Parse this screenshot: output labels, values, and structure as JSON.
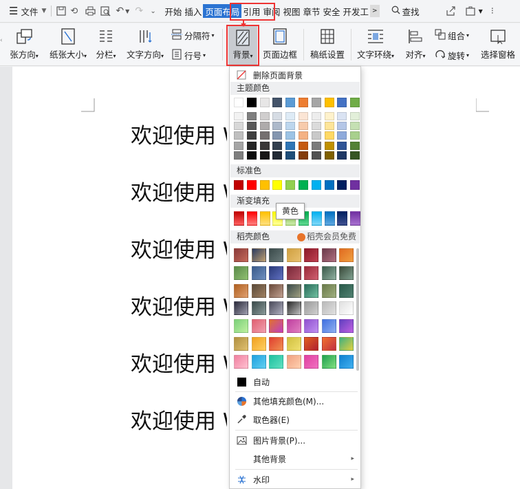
{
  "menubar": {
    "file_label": "文件",
    "tabs": [
      "开始",
      "插入",
      "页面布局",
      "引用",
      "审阅",
      "视图",
      "章节",
      "安全",
      "开发工"
    ],
    "active_tab": "页面布局",
    "more_glyph": ">",
    "search_label": "查找"
  },
  "ribbon": {
    "orientation": "张方向",
    "size": "纸张大小",
    "columns": "分栏",
    "text_direction": "文字方向",
    "separator": "分隔符",
    "line_number": "行号",
    "background": "背景",
    "page_border": "页面边框",
    "paper_setup": "稿纸设置",
    "text_wrap": "文字环绕",
    "align": "对齐",
    "group": "组合",
    "rotate": "旋转",
    "selection_pane": "选择窗格"
  },
  "document": {
    "lines": [
      "欢迎使用 W",
      "欢迎使用 W",
      "欢迎使用 W",
      "欢迎使用 W",
      "欢迎使用 W",
      "欢迎使用 W"
    ]
  },
  "dropdown": {
    "remove_bg": "删除页面背景",
    "theme_colors_title": "主题颜色",
    "standard_colors_title": "标准色",
    "gradient_title": "渐变填充",
    "docer_title": "稻壳颜色",
    "docer_vip": "稻壳会员免费",
    "auto": "自动",
    "more_fill": "其他填充颜色(M)...",
    "eyedropper": "取色器(E)",
    "picture_bg": "图片背景(P)...",
    "other_bg": "其他背景",
    "watermark": "水印",
    "tooltip": "黄色",
    "theme_top": [
      "#ffffff",
      "#000000",
      "#e7e6e6",
      "#44546a",
      "#5b9bd5",
      "#ed7d31",
      "#a5a5a5",
      "#ffc000",
      "#4472c4",
      "#70ad47"
    ],
    "theme_shades": [
      [
        "#f2f2f2",
        "#7f7f7f",
        "#d0cece",
        "#d6dce4",
        "#deebf6",
        "#fbe5d5",
        "#ededed",
        "#fff2cc",
        "#dae3f3",
        "#e2efd9"
      ],
      [
        "#d8d8d8",
        "#595959",
        "#aeabab",
        "#adb9ca",
        "#bdd7ee",
        "#f7cbac",
        "#dbdbdb",
        "#fee599",
        "#b4c6e7",
        "#c5e0b3"
      ],
      [
        "#bfbfbf",
        "#3f3f3f",
        "#757070",
        "#8496b0",
        "#9cc3e5",
        "#f4b183",
        "#c9c9c9",
        "#ffd965",
        "#8eaadb",
        "#a8d08d"
      ],
      [
        "#a5a5a5",
        "#262626",
        "#3a3838",
        "#323f4f",
        "#2e75b5",
        "#c55a11",
        "#7b7b7b",
        "#bf9000",
        "#2f5496",
        "#538135"
      ],
      [
        "#7f7f7f",
        "#0c0c0c",
        "#171616",
        "#222a35",
        "#1e4e79",
        "#843c0b",
        "#525252",
        "#7f6000",
        "#1f3864",
        "#375623"
      ]
    ],
    "standard": [
      "#c00000",
      "#ff0000",
      "#ffc000",
      "#ffff00",
      "#92d050",
      "#00b050",
      "#00b0f0",
      "#0070c0",
      "#002060",
      "#7030a0"
    ],
    "gradients": [
      [
        "#c00000",
        "#ff6060"
      ],
      [
        "#ff0000",
        "#ff8080"
      ],
      [
        "#ffc000",
        "#ffe080"
      ],
      [
        "#ffff00",
        "#ffff9a"
      ],
      [
        "#92d050",
        "#c8e8a8"
      ],
      [
        "#00b050",
        "#60d890"
      ],
      [
        "#00b0f0",
        "#80d8f8"
      ],
      [
        "#0070c0",
        "#60a8e0"
      ],
      [
        "#002060",
        "#405090"
      ],
      [
        "#7030a0",
        "#a870d0"
      ]
    ],
    "docer": [
      [
        [
          "#8a3a3a",
          "#c56a5a"
        ],
        [
          "#2a3a60",
          "#c0a070"
        ],
        [
          "#3a4a4a",
          "#6a7a7a"
        ],
        [
          "#d0a040",
          "#e8c070"
        ],
        [
          "#8a1a2a",
          "#c04050"
        ],
        [
          "#6a3a4a",
          "#b07080"
        ],
        [
          "#e06a20",
          "#f0a040"
        ]
      ],
      [
        [
          "#5a8a4a",
          "#90c070"
        ],
        [
          "#3a5a8a",
          "#7090c0"
        ],
        [
          "#2a3a7a",
          "#6070c0"
        ],
        [
          "#7a2a3a",
          "#b05060"
        ],
        [
          "#9a2a3a",
          "#d06070"
        ],
        [
          "#3a5a4a",
          "#90b0a0"
        ],
        [
          "#3a4a3a",
          "#80a090"
        ]
      ],
      [
        [
          "#b06020",
          "#e0a070"
        ],
        [
          "#5a4a3a",
          "#a08060"
        ],
        [
          "#6a4a3a",
          "#c0a090"
        ],
        [
          "#3a4a4a",
          "#a0a080"
        ],
        [
          "#2a6a5a",
          "#70c0a0"
        ],
        [
          "#6a7a4a",
          "#a0b080"
        ],
        [
          "#2a5a4a",
          "#508070"
        ]
      ],
      [
        [
          "#2a2a3a",
          "#a0a0b0"
        ],
        [
          "#3a4a4a",
          "#8a9a9a"
        ],
        [
          "#4a4a5a",
          "#b0b0c0"
        ],
        [
          "#2a2a2a",
          "#c0c0c0"
        ],
        [
          "#9a9a9a",
          "#d0d0d0"
        ],
        [
          "#bababa",
          "#e0e0e0"
        ],
        [
          "#e0e0e0",
          "#ffffff"
        ]
      ],
      [
        [
          "#7ad07a",
          "#c0f0a0"
        ],
        [
          "#e06070",
          "#f0a0b0"
        ],
        [
          "#e07030",
          "#c040c0"
        ],
        [
          "#c040a0",
          "#e080c0"
        ],
        [
          "#9050d0",
          "#c090f0"
        ],
        [
          "#4070e0",
          "#90b0f0"
        ],
        [
          "#6040c0",
          "#c060e0"
        ]
      ],
      [
        [
          "#b09040",
          "#e0c070"
        ],
        [
          "#f0a020",
          "#ffd060"
        ],
        [
          "#e04030",
          "#f09050"
        ],
        [
          "#d0c040",
          "#f0e070"
        ],
        [
          "#e06020",
          "#b02030"
        ],
        [
          "#f07030",
          "#c03040"
        ],
        [
          "#40b080",
          "#e0d040"
        ]
      ],
      [
        [
          "#f080a0",
          "#ffc0d0"
        ],
        [
          "#20a0e0",
          "#60d0f0"
        ],
        [
          "#20c0a0",
          "#60e0c0"
        ],
        [
          "#f0a080",
          "#ffd0b0"
        ],
        [
          "#e040a0",
          "#f070c0"
        ],
        [
          "#20a050",
          "#80e080"
        ],
        [
          "#1080d0",
          "#40b0f0"
        ]
      ]
    ],
    "auto_color": "#000000"
  },
  "colors": {
    "accent_blue": "#2b73d2",
    "highlight_red": "#e33333",
    "docer_orange": "#e8742a"
  }
}
